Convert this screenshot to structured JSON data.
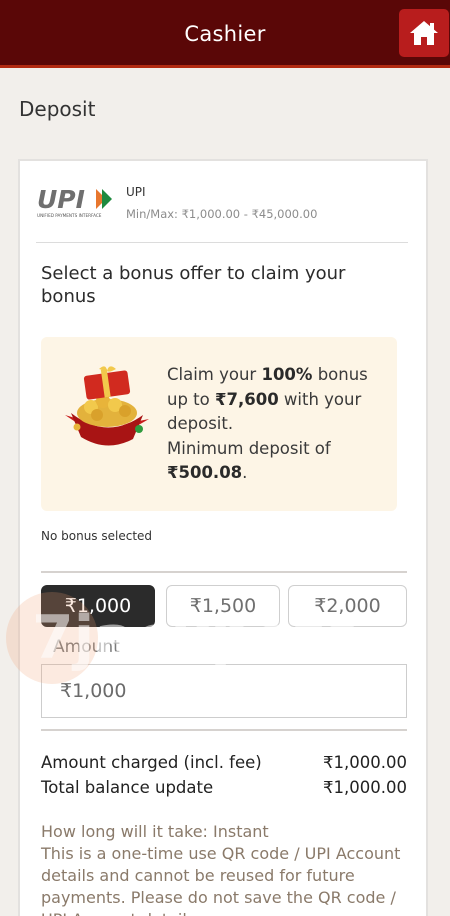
{
  "header": {
    "title": "Cashier",
    "home_icon": "home-icon"
  },
  "page": {
    "title": "Deposit"
  },
  "payment_method": {
    "logo_text": "UPI",
    "logo_subtext": "UNIFIED PAYMENTS INTERFACE",
    "name": "UPI",
    "limits": "Min/Max: ₹1,000.00 - ₹45,000.00"
  },
  "bonus": {
    "heading": "Select a bonus offer to claim your bonus",
    "offer": {
      "pre": "Claim your ",
      "percent": "100%",
      "mid1": " bonus up to ",
      "max": "₹7,600",
      "mid2": " with your deposit.",
      "min_label": "Minimum deposit of ",
      "min_amount": "₹500.08",
      "end": "."
    },
    "status": "No bonus selected"
  },
  "amount": {
    "chips": [
      "₹1,000",
      "₹1,500",
      "₹2,000"
    ],
    "selected_chip_index": 0,
    "label": "Amount",
    "value": "₹1,000"
  },
  "summary": {
    "charged_label": "Amount charged (incl. fee)",
    "charged_value": "₹1,000.00",
    "balance_label": "Total balance update",
    "balance_value": "₹1,000.00"
  },
  "info": {
    "time": "How long will it take: Instant",
    "note": "This is a one-time use QR code / UPI Account details and cannot be reused for future payments. Please do not save the QR code / UPI Account details."
  },
  "watermark": {
    "text": "7jackpots"
  },
  "colors": {
    "header_bg": "#5a0707",
    "home_button": "#b81d1d",
    "offer_bg": "#fdf5e6",
    "selected_chip": "#2b2b2b"
  }
}
